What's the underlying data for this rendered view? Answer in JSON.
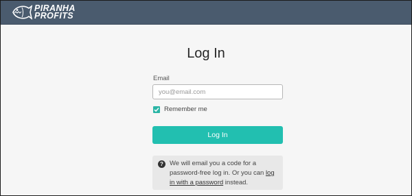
{
  "header": {
    "logo_line1": "PIRANHA",
    "logo_line2": "PROFITS",
    "logo_icon": "piranha-fish-icon"
  },
  "form": {
    "title": "Log In",
    "email_label": "Email",
    "email_value": "",
    "email_placeholder": "you@email.com",
    "remember_label": "Remember me",
    "remember_checked": true,
    "submit_label": "Log In"
  },
  "info": {
    "icon": "question-circle-icon",
    "text_before": "We will email you a code for a password-free log in. Or you can ",
    "link_text": "log in with a password",
    "text_after": " instead."
  },
  "colors": {
    "header_bg": "#4a5b6e",
    "accent": "#22bfb0",
    "page_bg": "#f6f6f6"
  }
}
